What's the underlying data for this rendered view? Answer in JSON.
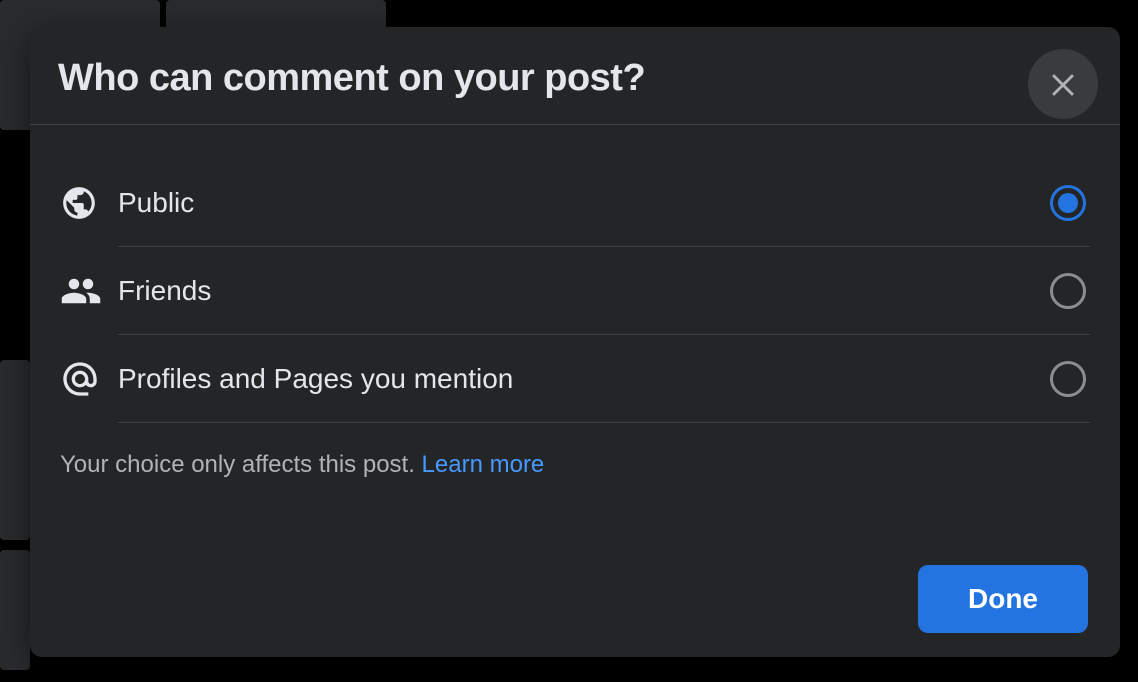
{
  "modal": {
    "title": "Who can comment on your post?",
    "close_aria": "Close",
    "options": [
      {
        "id": "public",
        "label": "Public",
        "icon": "globe-icon",
        "selected": true
      },
      {
        "id": "friends",
        "label": "Friends",
        "icon": "friends-icon",
        "selected": false
      },
      {
        "id": "mentions",
        "label": "Profiles and Pages you mention",
        "icon": "at-icon",
        "selected": false
      }
    ],
    "note": "Your choice only affects this post. ",
    "learn_more": "Learn more",
    "done_label": "Done"
  }
}
